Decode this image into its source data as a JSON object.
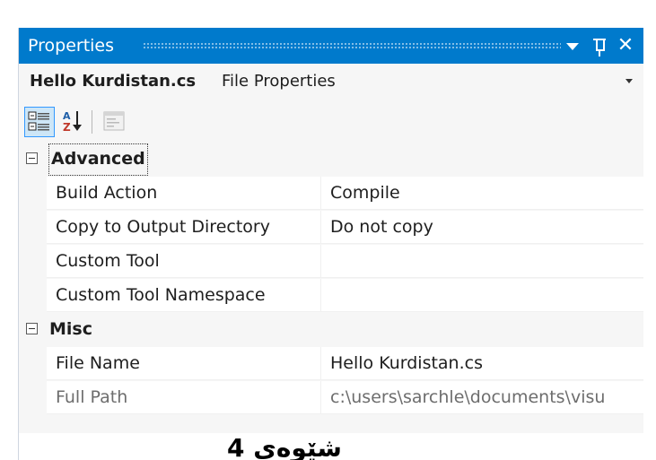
{
  "window": {
    "title": "Properties"
  },
  "object_selector": {
    "name": "Hello Kurdistan.cs",
    "type": "File Properties"
  },
  "toolbar": {
    "categorized_icon": "categorized-icon",
    "alphabetical_icon": "sort-az-icon",
    "property_pages_icon": "property-pages-icon"
  },
  "categories": [
    {
      "label": "Advanced",
      "properties": [
        {
          "name": "Build Action",
          "value": "Compile"
        },
        {
          "name": "Copy to Output Directory",
          "value": "Do not copy"
        },
        {
          "name": "Custom Tool",
          "value": ""
        },
        {
          "name": "Custom Tool Namespace",
          "value": ""
        }
      ]
    },
    {
      "label": "Misc",
      "properties": [
        {
          "name": "File Name",
          "value": "Hello Kurdistan.cs"
        },
        {
          "name": "Full Path",
          "value": "c:\\users\\sarchle\\documents\\visu"
        }
      ]
    }
  ],
  "preview": {
    "text": "شێوەی 4"
  },
  "colors": {
    "titlebar": "#007acc",
    "panel_bg": "#f6f6f6",
    "readonly_text": "#6d6d6d"
  }
}
